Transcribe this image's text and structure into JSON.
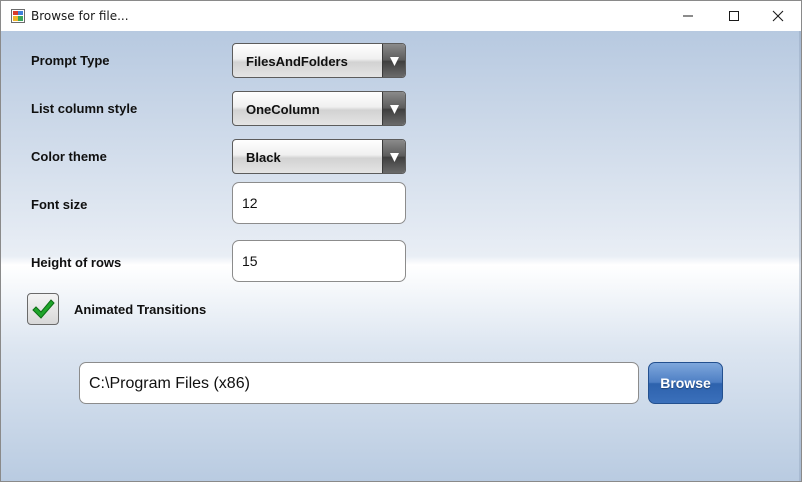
{
  "window": {
    "title": "Browse for file...",
    "icons": {
      "app": "app-icon",
      "minimize": "minimize-icon",
      "maximize": "maximize-icon",
      "close": "close-icon"
    }
  },
  "form": {
    "prompt_type": {
      "label": "Prompt Type",
      "value": "FilesAndFolders"
    },
    "list_column_style": {
      "label": "List column style",
      "value": "OneColumn"
    },
    "color_theme": {
      "label": "Color theme",
      "value": "Black"
    },
    "font_size": {
      "label": "Font size",
      "value": "12"
    },
    "row_height": {
      "label": "Height of rows",
      "value": "15"
    },
    "animated_transitions": {
      "label": "Animated Transitions",
      "checked": true
    }
  },
  "browse": {
    "path": "C:\\Program Files (x86)",
    "button_label": "Browse"
  },
  "colors": {
    "accent": "#3b70bb",
    "check": "#1fa52a"
  }
}
